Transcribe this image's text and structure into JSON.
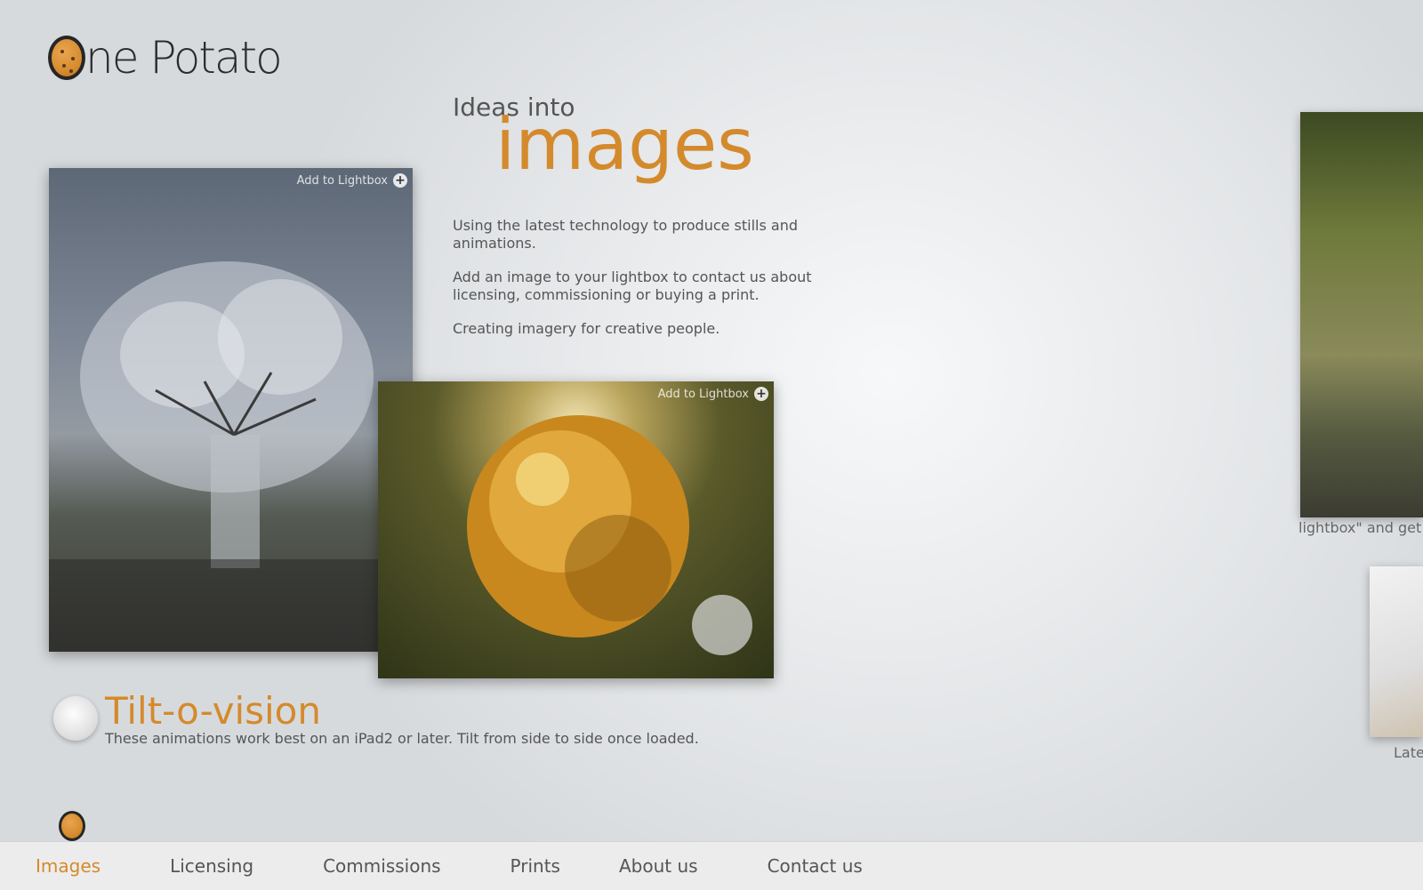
{
  "brand": {
    "name": "ne Potato",
    "accent_color": "#d48a2c"
  },
  "hero": {
    "kicker": "Ideas into",
    "headline": "images",
    "paragraphs": [
      "Using the latest technology to produce stills and animations.",
      "Add an image to your lightbox to contact us about licensing, commissioning or buying a print.",
      "Creating imagery for creative people."
    ]
  },
  "gallery": {
    "items": [
      {
        "lightbox_label": "Add to Lightbox",
        "icon": "plus-circle-icon"
      },
      {
        "lightbox_label": "Add to Lightbox",
        "icon": "plus-circle-icon"
      }
    ],
    "side_captions": [
      "lightbox\" and get i",
      "Late"
    ]
  },
  "tilt": {
    "title": "Tilt-o-vision",
    "description": "These animations work best on an iPad2 or later. Tilt from side to side once loaded."
  },
  "nav": {
    "items": [
      {
        "label": "Images",
        "active": true
      },
      {
        "label": "Licensing",
        "active": false
      },
      {
        "label": "Commissions",
        "active": false
      },
      {
        "label": "Prints",
        "active": false
      },
      {
        "label": "About us",
        "active": false
      },
      {
        "label": "Contact us",
        "active": false
      }
    ]
  }
}
